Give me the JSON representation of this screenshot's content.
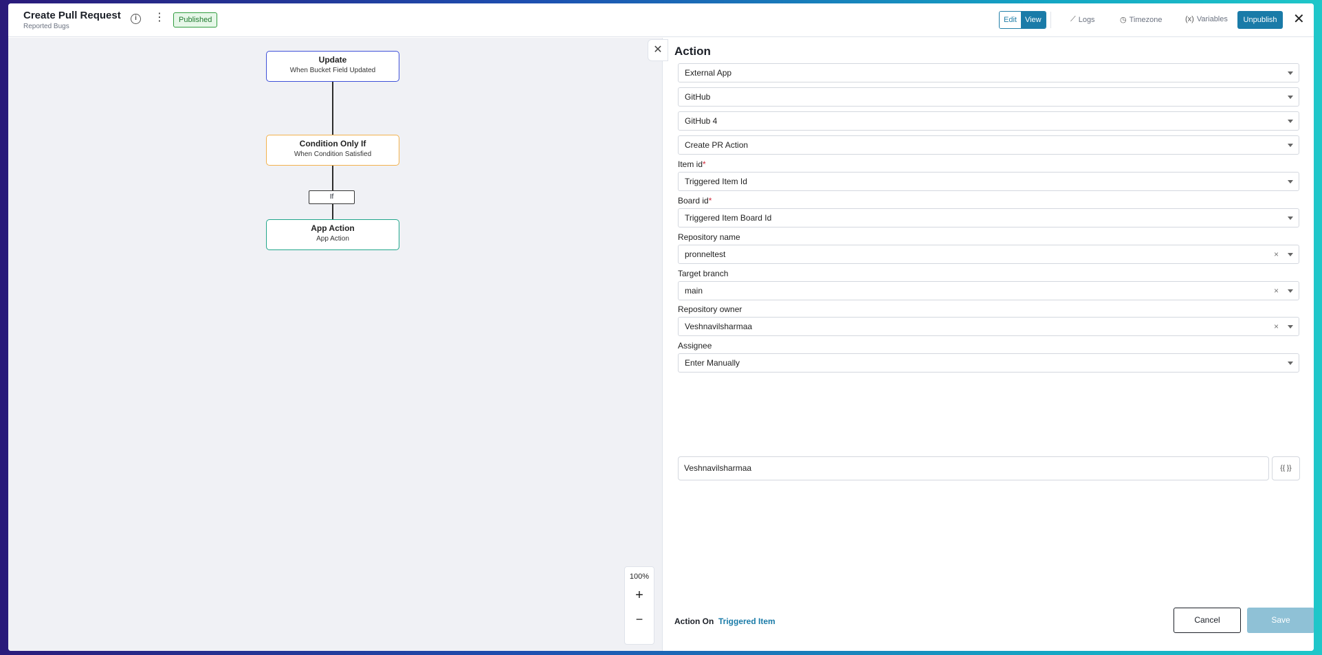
{
  "header": {
    "title": "Create Pull Request",
    "subtitle": "Reported Bugs",
    "info_icon": "i",
    "more_icon": "⋮",
    "status_badge": "Published",
    "mode_edit": "Edit",
    "mode_view": "View",
    "logs_label": "Logs",
    "timezone_label": "Timezone",
    "variables_label": "Variables",
    "unpublish_label": "Unpublish",
    "close_icon": "✕",
    "icons": {
      "logs": "chart-line-icon",
      "timezone": "clock-icon",
      "variables": "variables-icon"
    }
  },
  "canvas": {
    "nodes": [
      {
        "title": "Update",
        "subtitle": "When Bucket Field Updated",
        "accent": "#3d4fd8"
      },
      {
        "title": "Condition Only If",
        "subtitle": "When Condition Satisfied",
        "accent": "#f2b14b"
      },
      {
        "title": "App Action",
        "subtitle": "App Action",
        "accent": "#1fa58a"
      }
    ],
    "branch_label": "If",
    "zoom": {
      "level": "100%",
      "in": "+",
      "out": "−"
    }
  },
  "panel": {
    "close_icon": "✕",
    "title": "Action",
    "selects": {
      "action_type": "External App",
      "app": "GitHub",
      "connection": "GitHub 4",
      "action": "Create PR Action"
    },
    "fields": {
      "item_id": {
        "label": "Item id",
        "required": "*",
        "value": "Triggered Item Id"
      },
      "board_id": {
        "label": "Board id",
        "required": "*",
        "value": "Triggered Item Board Id"
      },
      "repository_name": {
        "label": "Repository name",
        "value": "pronneltest",
        "clear": "×"
      },
      "target_branch": {
        "label": "Target branch",
        "value": "main",
        "clear": "×"
      },
      "repository_owner": {
        "label": "Repository owner",
        "value": "Veshnavilsharmaa",
        "clear": "×"
      },
      "assignee": {
        "label": "Assignee",
        "value": "Enter Manually",
        "manual_value": "Veshnavilsharmaa",
        "var_button": "{{ }}"
      }
    },
    "footer": {
      "action_on_label": "Action On",
      "action_on_value": "Triggered Item",
      "cancel_label": "Cancel",
      "save_label": "Save"
    }
  },
  "colors": {
    "primary": "#1a7ba8",
    "badge_green": "#2e9b3c",
    "required": "#d0283a"
  }
}
